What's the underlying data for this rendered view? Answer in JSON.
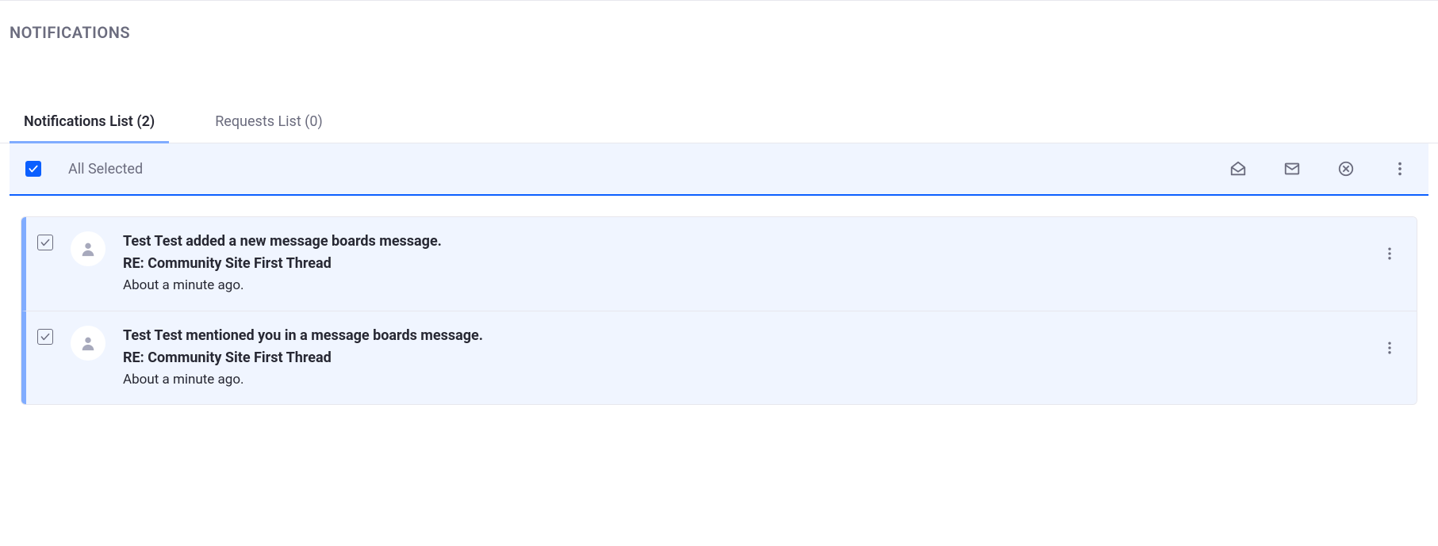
{
  "header": {
    "title": "NOTIFICATIONS"
  },
  "tabs": {
    "notifications": {
      "label": "Notifications List (2)"
    },
    "requests": {
      "label": "Requests List (0)"
    }
  },
  "toolbar": {
    "all_selected": "All Selected"
  },
  "items": [
    {
      "title": "Test Test added a new message boards message.",
      "subject": "RE: Community Site First Thread",
      "time": "About a minute ago."
    },
    {
      "title": "Test Test mentioned you in a message boards message.",
      "subject": "RE: Community Site First Thread",
      "time": "About a minute ago."
    }
  ]
}
